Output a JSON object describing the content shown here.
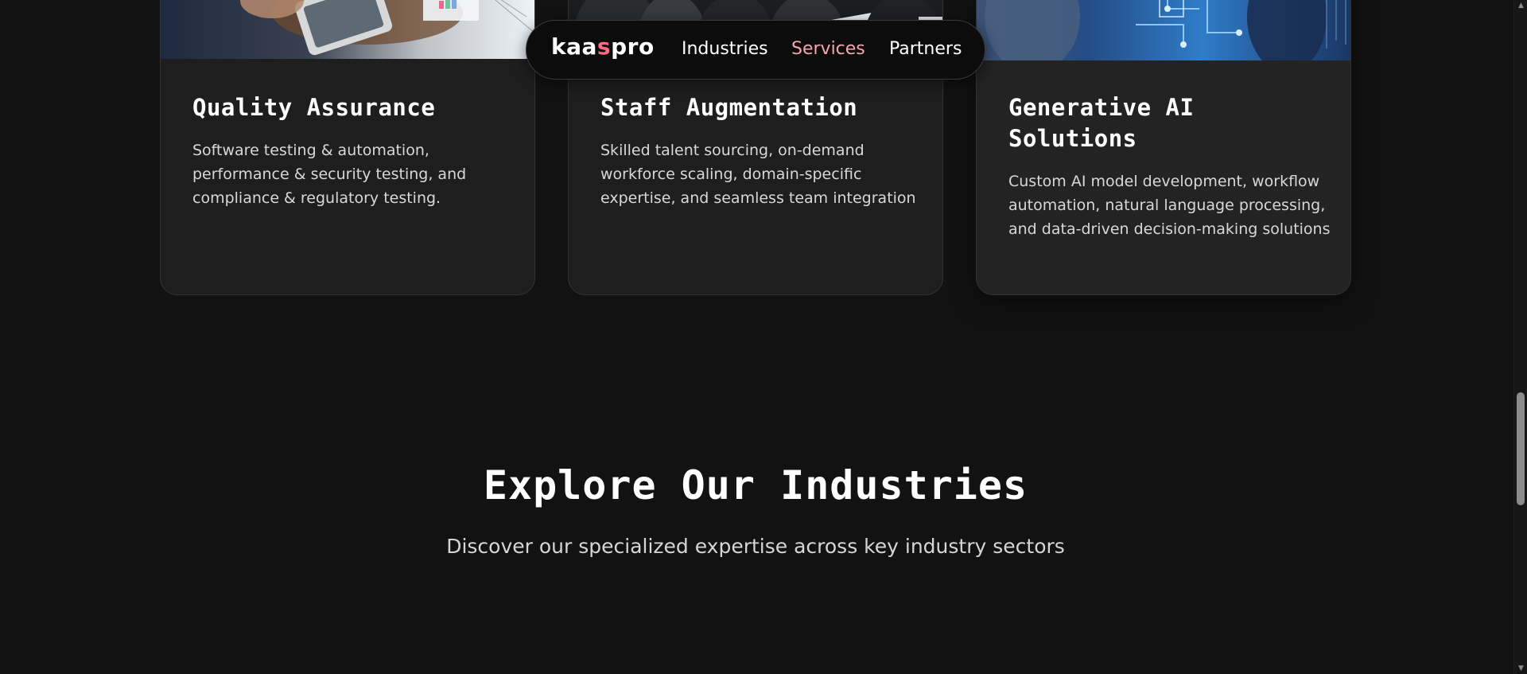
{
  "nav": {
    "logo": {
      "part1": "kaa",
      "accent": "s",
      "part2": "pro"
    },
    "links": [
      {
        "label": "Industries"
      },
      {
        "label": "Services"
      },
      {
        "label": "Partners"
      }
    ],
    "active_color": "#f3a5b3",
    "logo_accent_color": "#ff6b81"
  },
  "cards": [
    {
      "title": "Quality Assurance",
      "description": "Software testing & automation, performance & security testing, and compliance & regulatory testing."
    },
    {
      "title": "Staff Augmentation",
      "description": "Skilled talent sourcing, on-demand workforce scaling, domain-specific expertise, and seamless team integration"
    },
    {
      "title": "Generative AI Solutions",
      "description": "Custom AI model development, workflow automation, natural language processing, and data-driven decision-making solutions"
    }
  ],
  "section": {
    "title": "Explore Our Industries",
    "subtitle": "Discover our specialized expertise across key industry sectors"
  },
  "scrollbar": {
    "up_icon": "▲",
    "down_icon": "▼"
  },
  "colors": {
    "background": "#121212",
    "card_background": "#1e1e1f",
    "card_border": "#333336"
  }
}
